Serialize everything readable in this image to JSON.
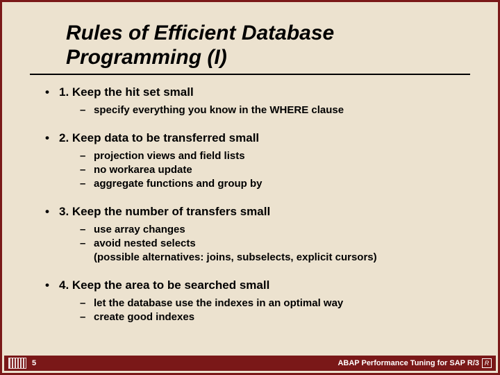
{
  "slide": {
    "title": "Rules of Efficient Database Programming (I)",
    "bullets": [
      {
        "text": "1. Keep the hit set small",
        "sub": [
          "specify everything you know in the WHERE clause"
        ]
      },
      {
        "text": "2. Keep data to be transferred small",
        "sub": [
          "projection views and field lists",
          "no workarea update",
          "aggregate functions and group by"
        ]
      },
      {
        "text": "3. Keep the number of transfers small",
        "sub": [
          "use array changes",
          "avoid nested selects\n(possible alternatives: joins, subselects, explicit cursors)"
        ]
      },
      {
        "text": "4. Keep the area to be searched small",
        "sub": [
          "let the database use the indexes in an optimal way",
          "create good indexes"
        ]
      }
    ]
  },
  "footer": {
    "page_number": "5",
    "right_text": "ABAP Performance Tuning for SAP R/3"
  }
}
